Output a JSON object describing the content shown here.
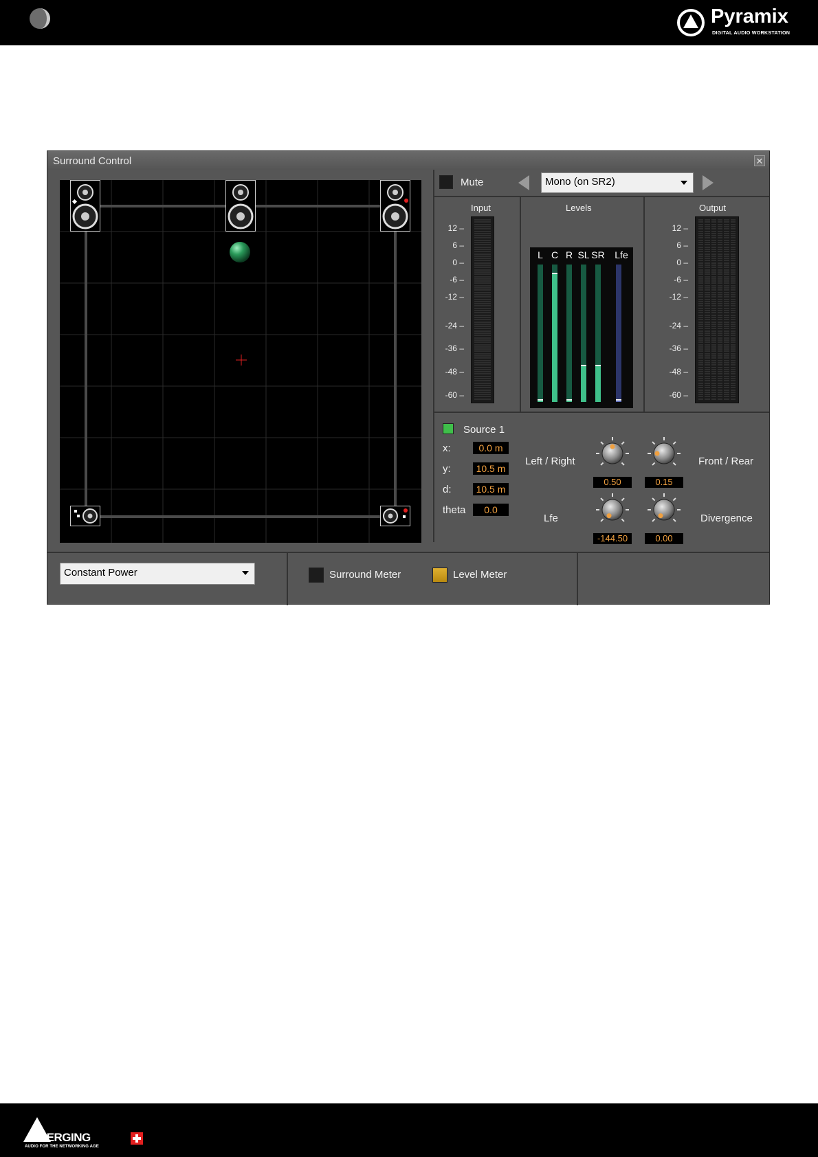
{
  "page": {
    "brand": {
      "name": "Pyramix",
      "tagline": "DIGITAL AUDIO WORKSTATION"
    },
    "footer_brand": {
      "name": "MERGING",
      "tagline": "AUDIO FOR THE NETWORKING AGE"
    }
  },
  "window": {
    "title": "Surround Control",
    "mute_label": "Mute",
    "source_select": "Mono (on SR2)",
    "input_label": "Input",
    "levels_label": "Levels",
    "output_label": "Output",
    "channels": [
      "L",
      "C",
      "R",
      "SL",
      "SR",
      "Lfe"
    ],
    "channel_levels": [
      0.0,
      0.93,
      0.0,
      0.26,
      0.26,
      0.0
    ],
    "db_scale": [
      "12",
      "6",
      "0",
      "-6",
      "-12",
      "-24",
      "-36",
      "-48",
      "-60"
    ],
    "source": {
      "label": "Source 1",
      "x_label": "x:",
      "x_value": "0.0 m",
      "y_label": "y:",
      "y_value": "10.5 m",
      "d_label": "d:",
      "d_value": "10.5 m",
      "theta_label": "theta",
      "theta_value": "0.0"
    },
    "knobs": {
      "left_right": {
        "label": "Left / Right",
        "value": "0.50"
      },
      "front_rear": {
        "label": "Front / Rear",
        "value": "0.15"
      },
      "lfe": {
        "label": "Lfe",
        "value": "-144.50"
      },
      "divergence": {
        "label": "Divergence",
        "value": "0.00"
      }
    },
    "mode_select": "Constant Power",
    "surround_meter_label": "Surround Meter",
    "level_meter_label": "Level Meter",
    "colors": {
      "accent": "#f0a040",
      "led_green": "#3fbf4a",
      "meter_green": "#3fc08a",
      "lfe_blue": "#5a6ab8",
      "source_ball": "#2a9a5a"
    }
  }
}
